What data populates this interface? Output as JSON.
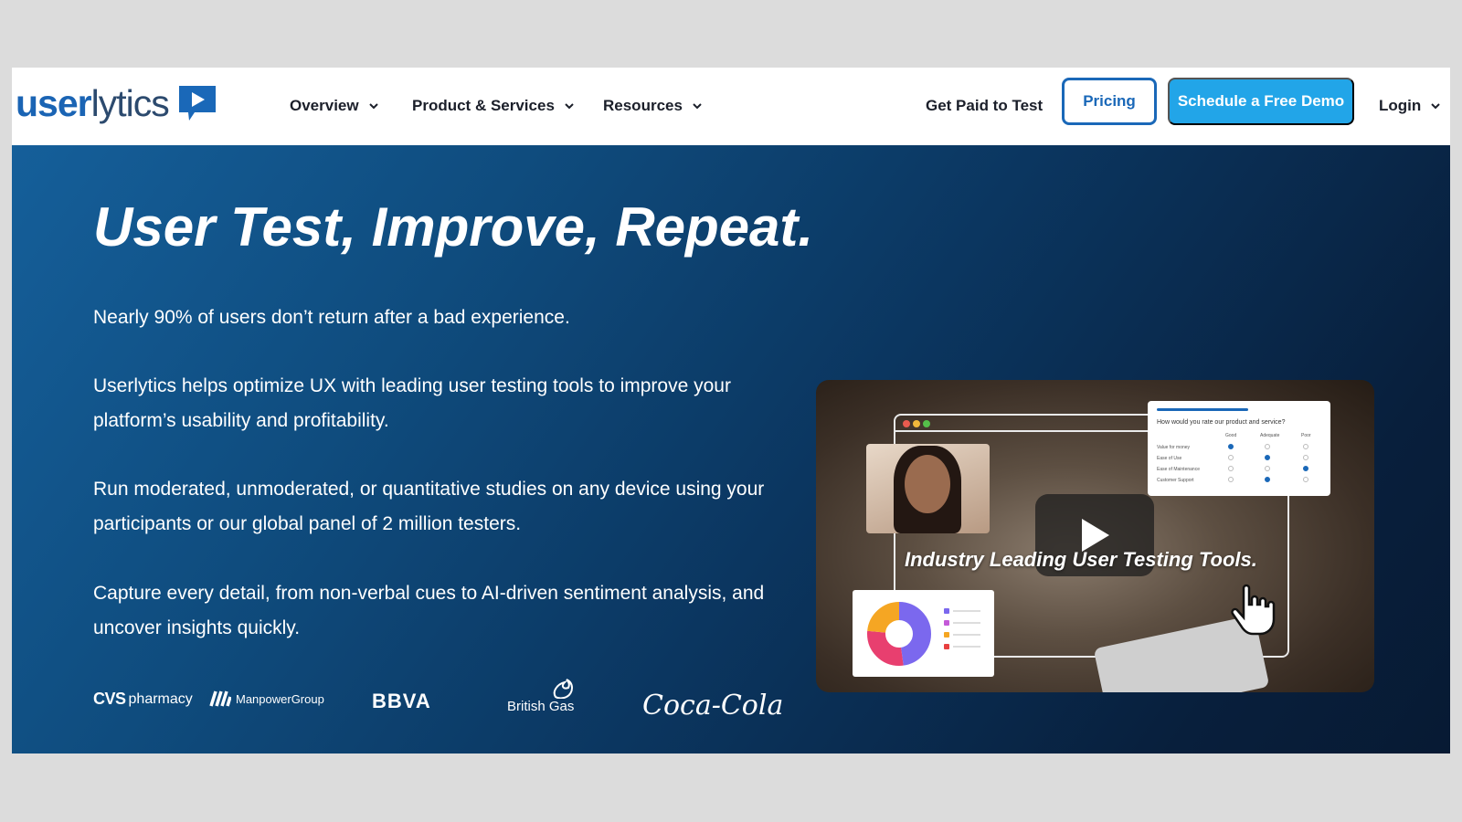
{
  "logo": {
    "bold": "user",
    "light": "lytics"
  },
  "nav": {
    "overview": "Overview",
    "products": "Product & Services",
    "resources": "Resources",
    "get_paid": "Get Paid to Test",
    "pricing": "Pricing",
    "demo": "Schedule a Free Demo",
    "login": "Login"
  },
  "hero": {
    "headline": "User Test, Improve, Repeat.",
    "p1": "Nearly 90% of users don’t return after a bad experience.",
    "p2": "Userlytics helps optimize UX with leading user testing tools to improve your platform’s usability and profitability.",
    "p3": "Run moderated, unmoderated, or quantitative studies on any device using your participants or our global panel of 2 million testers.",
    "p4": "Capture every detail, from non-verbal cues to AI-driven sentiment analysis, and uncover insights quickly."
  },
  "video": {
    "caption": "Industry Leading User Testing Tools.",
    "survey_title": "How would you rate our product and service?",
    "survey_cols": [
      "Good",
      "Adequate",
      "Poor"
    ],
    "survey_rows": [
      "Value for money",
      "Ease of Use",
      "Ease of Maintenance",
      "Customer Support"
    ]
  },
  "brands": {
    "cvs_bold": "CVS",
    "cvs_rest": "pharmacy",
    "manpower": "ManpowerGroup",
    "bbva": "BBVA",
    "britishgas": "British Gas",
    "cocacola": "Coca-Cola"
  },
  "colors": {
    "brand_blue": "#1a68b8",
    "cta": "#22a5e8",
    "hero_dark": "#0b3660"
  }
}
